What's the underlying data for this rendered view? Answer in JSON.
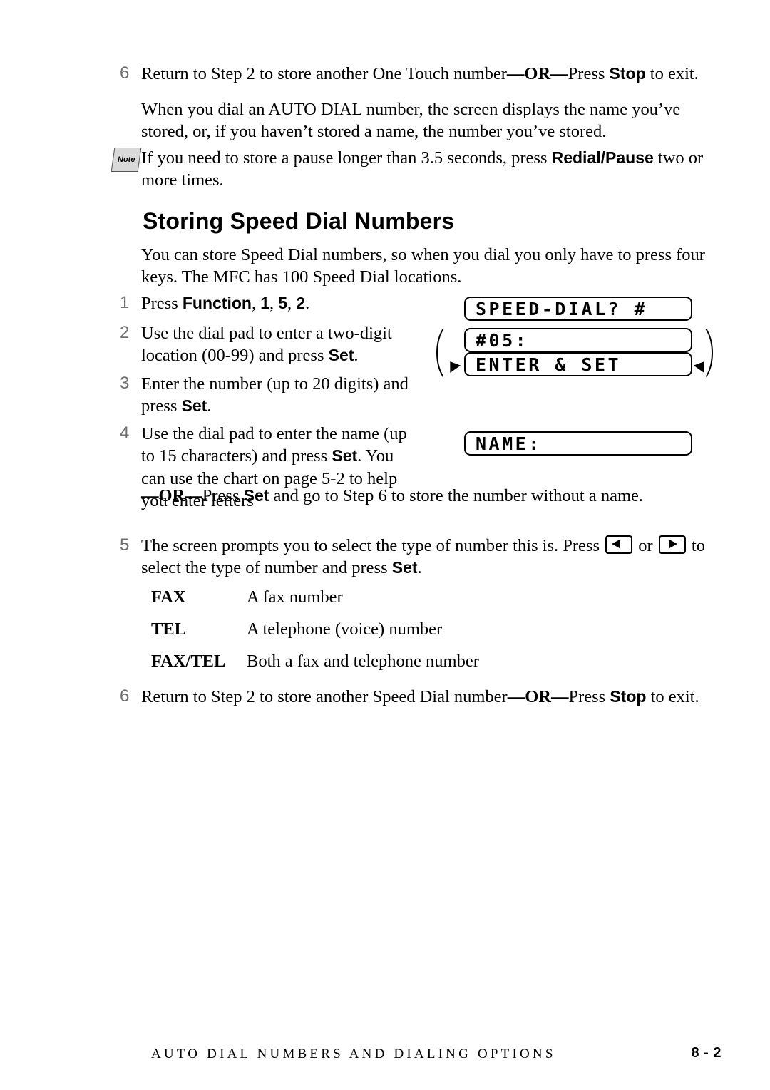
{
  "note_icon_label": "Note",
  "heading": "Storing Speed Dial Numbers",
  "step6_top": {
    "num": "6",
    "text_a": "Return to Step 2 to store another One Touch number",
    "dash1": "—",
    "or": "OR",
    "dash2": "—",
    "press": "Press ",
    "stop": "Stop",
    "text_b": " to exit."
  },
  "paragraph_auto_dial": "When you dial an AUTO DIAL number, the screen displays the name you’ve stored, or, if you haven’t stored a name, the number you’ve stored.",
  "note": {
    "text_a": "If you need to store a pause longer than 3.5 seconds, press ",
    "bold": "Redial/Pause",
    "text_b": " two or more times."
  },
  "intro": "You can store Speed Dial numbers, so when you dial you only have to press four keys. The MFC has 100 Speed Dial locations.",
  "steps": [
    {
      "num": "1",
      "press": "Press ",
      "b_function": "Function",
      "sep1": ", ",
      "b_1": "1",
      "sep2": ", ",
      "b_5": "5",
      "sep3": ", ",
      "b_2": "2",
      "period": "."
    },
    {
      "num": "2",
      "text_a": "Use the dial pad to enter a two-digit location (00-99) and press ",
      "bold": "Set",
      "text_b": "."
    },
    {
      "num": "3",
      "text_a": "Enter the number (up to 20 digits) and press ",
      "bold": "Set",
      "text_b": "."
    },
    {
      "num": "4",
      "text_a": "Use the dial pad to enter the name (up to 15 characters) and press ",
      "bold_set1": "Set",
      "text_b": ". You can use the chart on page 5-2 to help you enter letters",
      "dash1": "—",
      "or": "OR",
      "dash2": "—",
      "press": "Press ",
      "bold_set2": "Set",
      "text_c": " and go to Step 6 to store the number without a name."
    },
    {
      "num": "5",
      "text_a": "The screen prompts you to select the type of number this is. Press ",
      "key_left": "left-arrow-key",
      "mid": " or ",
      "key_right": "right-arrow-key",
      "text_b": " to select the type of number and press ",
      "bold": "Set",
      "text_c": "."
    },
    {
      "num": "6",
      "text_a": "Return to Step 2 to store another Speed Dial number",
      "dash1": "—",
      "or": "OR",
      "dash2": "—",
      "press": "Press ",
      "stop": "Stop",
      "text_b": " to exit."
    }
  ],
  "lcd": {
    "panel1": "SPEED-DIAL? #",
    "panel2": "#05:",
    "panel3": "ENTER & SET",
    "panel4": "NAME:"
  },
  "type_table": [
    {
      "key": "FAX",
      "desc": "A fax number"
    },
    {
      "key": "TEL",
      "desc": "A telephone (voice) number"
    },
    {
      "key": "FAX/TEL",
      "desc": "Both a fax and telephone number"
    }
  ],
  "footer": {
    "text": "AUTO DIAL NUMBERS AND DIALING OPTIONS",
    "page": "8 - 2"
  }
}
